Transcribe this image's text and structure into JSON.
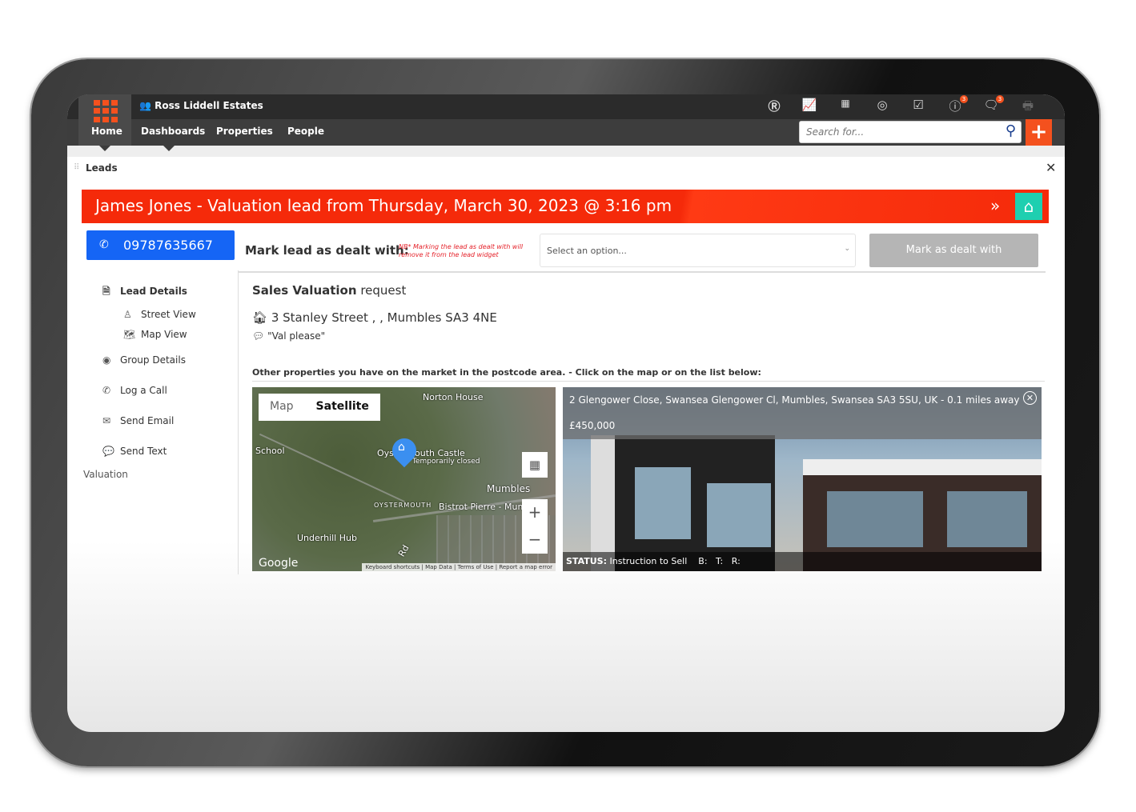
{
  "app": {
    "brand": "Ross Liddell Estates"
  },
  "nav": {
    "items": [
      "Home",
      "Dashboards",
      "Properties",
      "People"
    ]
  },
  "toolbar": {
    "icons": [
      "r-icon",
      "chart-icon",
      "calendar-icon",
      "target-icon",
      "checkbox-icon",
      "alert-icon",
      "chat-icon",
      "printer-icon"
    ],
    "alerts_badge": "3",
    "messages_badge": "3"
  },
  "search": {
    "placeholder": "Search for..."
  },
  "widget": {
    "title": "Leads"
  },
  "lead": {
    "banner": "James Jones - Valuation lead from Thursday, March 30, 2023 @ 3:16 pm",
    "phone": "09787635667"
  },
  "sidebar": {
    "items": [
      "Lead Details",
      "Street View",
      "Map View",
      "Group Details",
      "Log a Call",
      "Send Email",
      "Send Text"
    ],
    "footer": "Valuation"
  },
  "deal": {
    "label": "Mark lead as dealt with:",
    "note": "NB* Marking the lead as dealt with will remove it from the lead widget",
    "select_placeholder": "Select an option...",
    "button": "Mark as dealt with"
  },
  "request": {
    "type_bold": "Sales Valuation",
    "type_rest": " request",
    "address": "3 Stanley Street , ,  Mumbles SA3 4NE",
    "note": "\"Val please\""
  },
  "other": {
    "heading": "Other properties you have on the market in the postcode area. - Click on the map or on the list below:"
  },
  "map": {
    "tabs": [
      "Map",
      "Satellite"
    ],
    "active_tab": "Satellite",
    "labels": [
      "Norton House",
      "School",
      "Oystermouth Castle",
      "Temporarily closed",
      "Mumbles",
      "OYSTERMOUTH",
      "Bistrot Pierre - Mum",
      "Underhill Hub",
      "Rd"
    ],
    "footer": [
      "Keyboard shortcuts",
      "Map Data",
      "Terms of Use",
      "Report a map error"
    ],
    "logo": "Google"
  },
  "property": {
    "address": "2 Glengower Close, Swansea Glengower Cl, Mumbles, Swansea SA3 5SU, UK - 0.1 miles away",
    "price": "£450,000",
    "status_label": "STATUS:",
    "status": "Instruction to Sell",
    "beds": "B:",
    "toilets": "T:",
    "receptions": "R:"
  },
  "colors": {
    "accent": "#f4511e",
    "banner": "#f52a0a",
    "phone": "#1565f5",
    "home": "#1ecfb0"
  }
}
